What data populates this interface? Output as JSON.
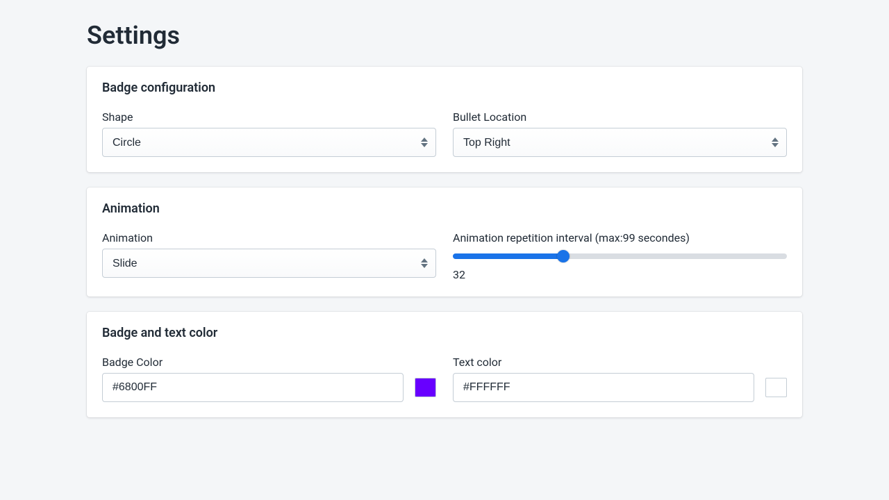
{
  "page": {
    "title": "Settings"
  },
  "badge_config": {
    "section_title": "Badge configuration",
    "shape_label": "Shape",
    "shape_value": "Circle",
    "location_label": "Bullet Location",
    "location_value": "Top Right"
  },
  "animation": {
    "section_title": "Animation",
    "animation_label": "Animation",
    "animation_value": "Slide",
    "interval_label": "Animation repetition interval (max:99 secondes)",
    "interval_value": "32",
    "interval_max": "99",
    "interval_pct": "32%"
  },
  "colors": {
    "section_title": "Badge and text color",
    "badge_label": "Badge Color",
    "badge_value": "#6800FF",
    "text_label": "Text color",
    "text_value": "#FFFFFF"
  }
}
